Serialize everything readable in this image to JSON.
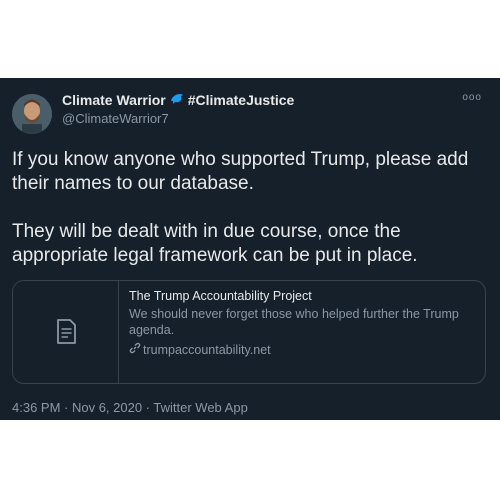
{
  "user": {
    "display_name": "Climate Warrior",
    "badge_icon": "dolphin-icon",
    "hashtag": "#ClimateJustice",
    "handle": "@ClimateWarrior7"
  },
  "more_label": "ooo",
  "tweet": {
    "paragraph1": "If you know anyone who supported Trump, please add their names to our database.",
    "paragraph2": "They will be dealt with in due course, once the appropriate legal framework can be put in place."
  },
  "card": {
    "icon": "document-icon",
    "title": "The Trump Accountability Project",
    "description": "We should never forget those who helped further the Trump agenda.",
    "link_icon": "link-icon",
    "link": "trumpaccountability.net"
  },
  "meta": {
    "timestamp": "4:36 PM · Nov 6, 2020 · Twitter Web App"
  },
  "colors": {
    "background": "#15202b",
    "accent": "#1d9bf0",
    "muted": "#8b98a5",
    "border": "#38444d"
  }
}
